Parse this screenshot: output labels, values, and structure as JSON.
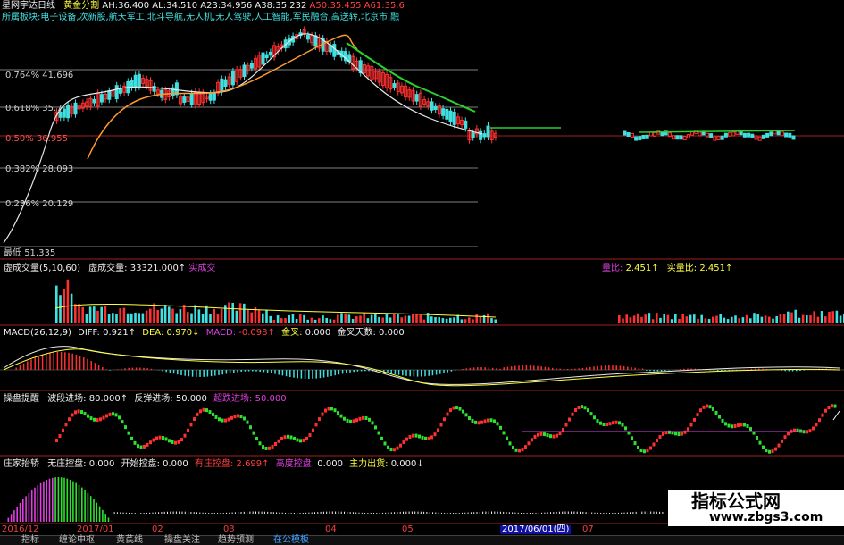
{
  "colors": {
    "bg": "#000000",
    "up": "#ff3030",
    "down": "#40e0e0",
    "white_line": "#e8e8e8",
    "orange_line": "#ff9a30",
    "green_line": "#28d028",
    "red_grid": "#a02020",
    "gray_grid": "#808080",
    "yellow": "#ffff40",
    "magenta": "#e040e0",
    "label_red": "#ff4040",
    "label_cyan": "#40e0e0",
    "label_white": "#f0f0f0"
  },
  "title_bar": {
    "window_title": "星网宇达日线",
    "study": "黄金分割",
    "values": [
      {
        "k": "AH:",
        "v": "36.400"
      },
      {
        "k": "AL:",
        "v": "34.510"
      },
      {
        "k": "A23:",
        "v": "34.956"
      },
      {
        "k": "A38:",
        "v": "35.232"
      },
      {
        "k": "A50:",
        "v": "35.455"
      },
      {
        "k": "A61:",
        "v": "35.6"
      }
    ]
  },
  "sector_line": "所属板块:电子设备,次新股,航天军工,北斗导航,无人机,无人驾驶,人工智能,军民融合,高送转,北京市,融",
  "fib_levels": [
    {
      "label": "0.764% 41.696",
      "level": 0.764
    },
    {
      "label": "0.618% 35.7",
      "level": 0.618
    },
    {
      "label": "0.50% 36.955",
      "level": 0.5
    },
    {
      "label": "0.382% 28.093",
      "level": 0.382
    },
    {
      "label": "0.236% 20.129",
      "level": 0.236
    }
  ],
  "price_low_label": "最低",
  "price_low_value": "51.335",
  "volume_panel": {
    "name": "虚成交量(5,10,60)",
    "v1_label": "虚成交量:",
    "v1_value": "33321.000↑",
    "v1_tail": "实成交",
    "ratio_label": "量比:",
    "ratio_value": "2.451↑",
    "real_ratio_label": "实量比:",
    "real_ratio_value": "2.451↑"
  },
  "macd_panel": {
    "name": "MACD(26,12,9)",
    "diff_label": "DIFF:",
    "diff_value": "0.921↑",
    "dea_label": "DEA:",
    "dea_value": "0.970↓",
    "macd_label": "MACD:",
    "macd_value": "-0.098↑",
    "gold_label": "金叉:",
    "gold_value": "0.000",
    "gold_days_label": "金叉天数:",
    "gold_days_value": "0.000"
  },
  "trade_panel": {
    "name": "操盘提醒",
    "wave_label": "波段进场:",
    "wave_value": "80.000↑",
    "rebound_label": "反弹进场:",
    "rebound_value": "50.000",
    "oversold_label": "超跌进场:",
    "oversold_value": "50.000"
  },
  "dealer_panel": {
    "name": "庄家抬轿",
    "no_label": "无庄控盘:",
    "no_value": "0.000",
    "start_label": "开始控盘:",
    "start_value": "0.000",
    "has_label": "有庄控盘:",
    "has_value": "2.699↑",
    "high_label": "高度控盘:",
    "high_value": "0.000",
    "main_label": "主力出货:",
    "main_value": "0.000↓"
  },
  "date_axis": [
    "2016/12",
    "2017/01",
    "02",
    "03",
    "04",
    "05",
    "2017/06/01(四)",
    "07"
  ],
  "bottom_tabs": [
    "指标",
    "缠论中枢",
    "黄芪线",
    "操盘关注",
    "趋势预测",
    "在公模板"
  ],
  "watermark": {
    "line1": "指标公式网",
    "line2": "www.zbgs3.com"
  }
}
